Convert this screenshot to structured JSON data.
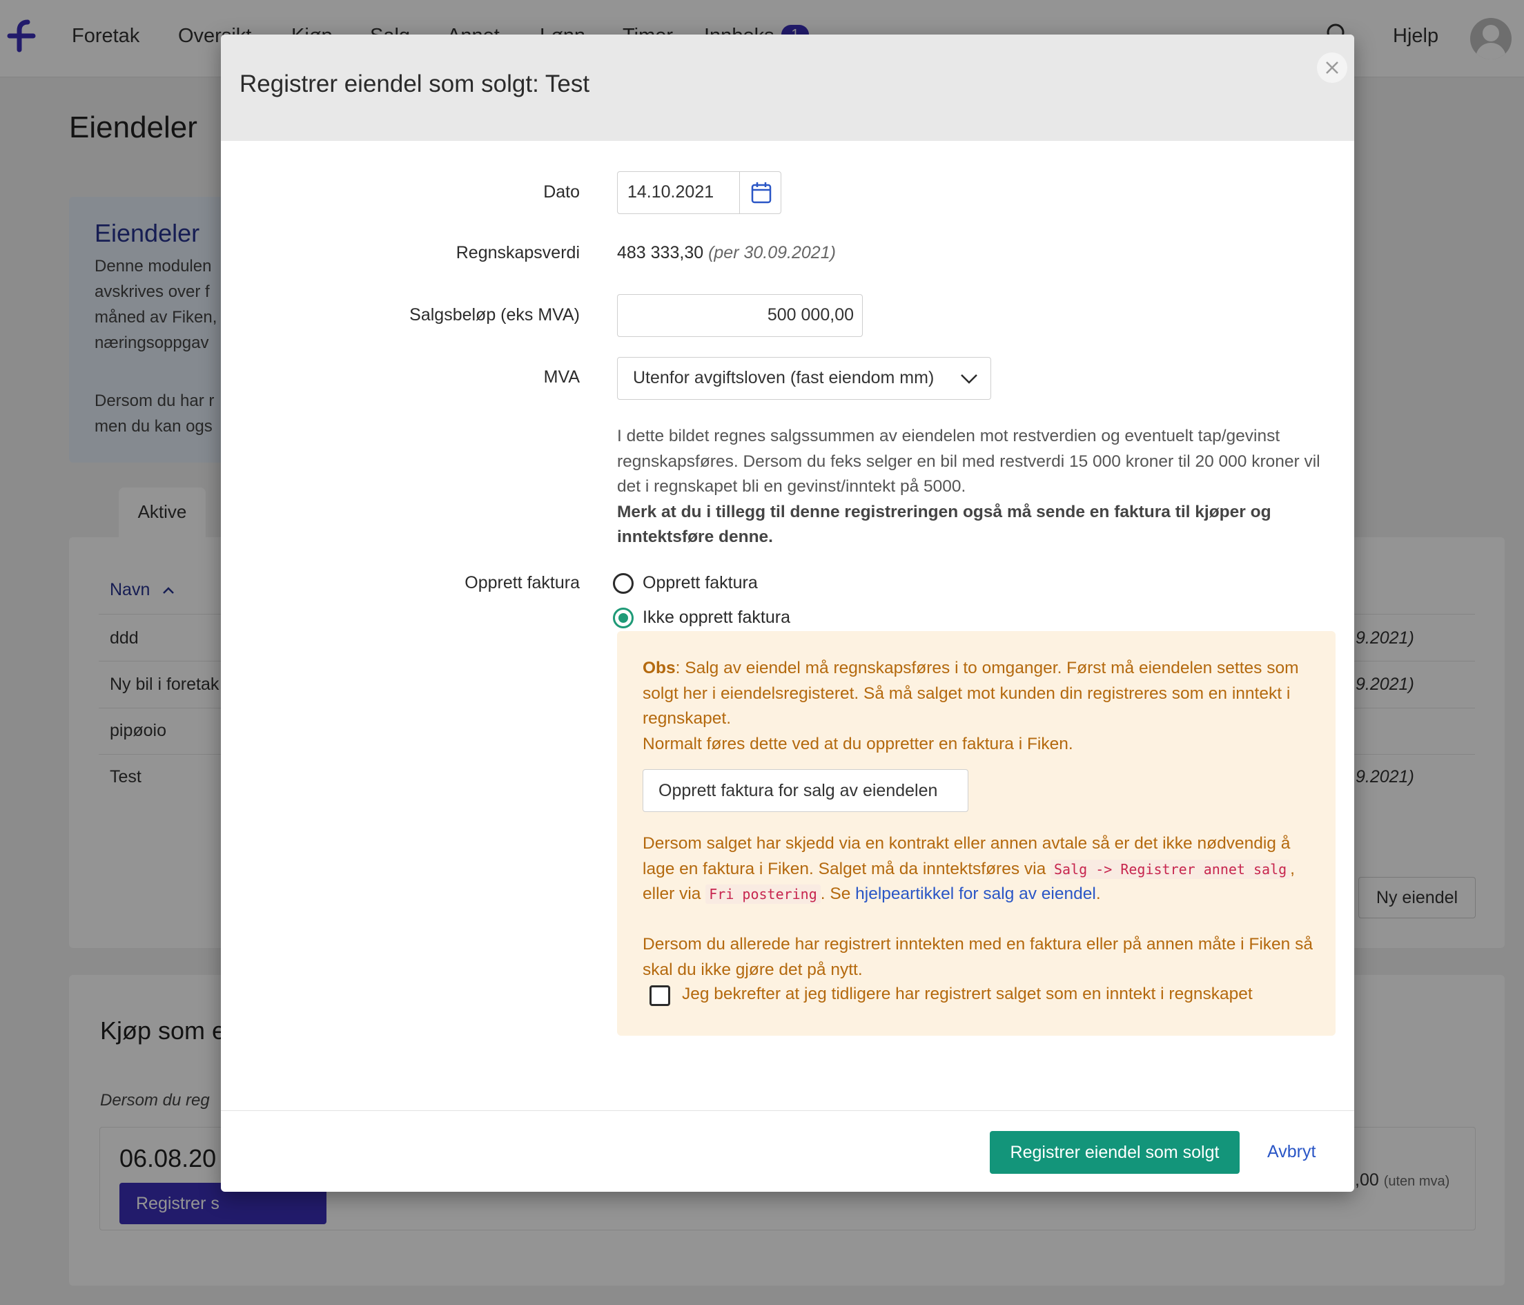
{
  "topnav": {
    "items": [
      "Foretak",
      "Oversikt",
      "Kjøp",
      "Salg",
      "Annet",
      "Lønn",
      "Timer",
      "Innboks"
    ],
    "inbox_badge": "1",
    "help": "Hjelp"
  },
  "page": {
    "title": "Eiendeler",
    "info_title": "Eiendeler",
    "info_lines": [
      "Denne modulen",
      "avskrives over f",
      "måned av Fiken,",
      "næringsoppgav"
    ],
    "info_lines_2": [
      "Dersom du har r",
      "men du kan ogs"
    ],
    "tab_active": "Aktive",
    "col_header": "Navn",
    "rows": [
      {
        "name": "ddd",
        "right": "9.2021)"
      },
      {
        "name": "Ny bil i foretak",
        "right": "9.2021)"
      },
      {
        "name": "pipøoio",
        "right": ""
      },
      {
        "name": "Test",
        "right": "9.2021)"
      }
    ],
    "new_button": "Ny eiendel",
    "buy_title": "Kjøp som e",
    "buy_sub": "Dersom du reg",
    "buy_date": "06.08.20",
    "buy_button": "Registrer s",
    "buy_amount": ",00",
    "buy_amount_note": "(uten mva)"
  },
  "modal": {
    "title": "Registrer eiendel som solgt: Test",
    "fields": {
      "date_label": "Dato",
      "date_value": "14.10.2021",
      "book_value_label": "Regnskapsverdi",
      "book_value": "483 333,30",
      "book_value_per": "(per 30.09.2021)",
      "sale_label": "Salgsbeløp (eks MVA)",
      "sale_value": "500 000,00",
      "mva_label": "MVA",
      "mva_value": "Utenfor avgiftsloven (fast eiendom mm)"
    },
    "description": "I dette bildet regnes salgssummen av eiendelen mot restverdien og eventuelt tap/gevinst regnskapsføres. Dersom du feks selger en bil med restverdi 15 000 kroner til 20 000 kroner vil det i regnskapet bli en gevinst/inntekt på 5000.",
    "description_bold": "Merk at du i tillegg til denne registreringen også må sende en faktura til kjøper og inntektsføre denne.",
    "invoice_label": "Opprett faktura",
    "radio_create": "Opprett faktura",
    "radio_no_create": "Ikke opprett faktura",
    "obs": {
      "prefix": "Obs",
      "text1": ": Salg av eiendel må regnskapsføres i to omganger. Først må eiendelen settes som solgt her i eiendelsregisteret. Så må salget mot kunden din registreres som en inntekt i regnskapet.",
      "text2": "Normalt føres dette ved at du oppretter en faktura i Fiken.",
      "button": "Opprett faktura for salg av eiendelen",
      "text3a": "Dersom salget har skjedd via en kontrakt eller annen avtale så er det ikke nødvendig å lage en faktura i Fiken. Salget må da inntektsføres via ",
      "code1": "Salg -> Registrer annet salg",
      "text3b": ", eller via ",
      "code2": "Fri postering",
      "text3c": ". Se ",
      "link": "hjelpeartikkel for salg av eiendel",
      "text3d": ".",
      "text4": "Dersom du allerede har registrert inntekten med en faktura eller på annen måte i Fiken så skal du ikke gjøre det på nytt.",
      "checkbox_label": "Jeg bekrefter at jeg tidligere har registrert salget som en inntekt i regnskapet"
    },
    "submit": "Registrer eiendel som solgt",
    "cancel": "Avbryt"
  },
  "colors": {
    "primary_green": "#13957a",
    "brand_purple": "#3b2fb8",
    "warning_text": "#b4690e",
    "warning_bg": "#fdf2e1",
    "link_blue": "#2a56c6"
  }
}
